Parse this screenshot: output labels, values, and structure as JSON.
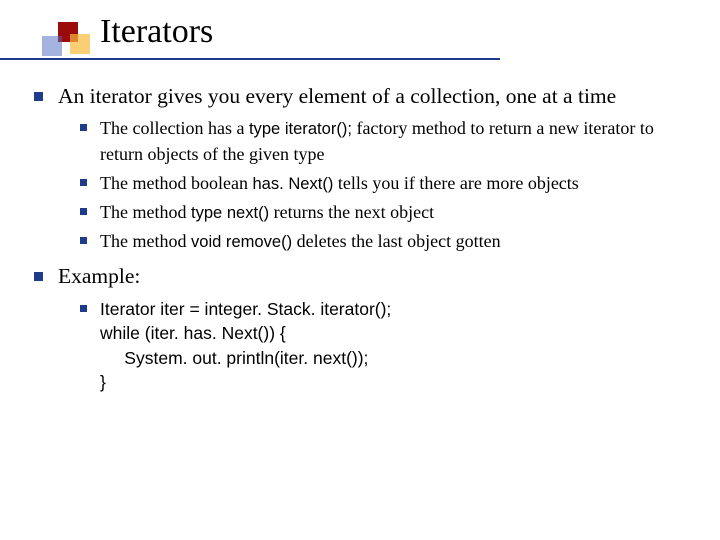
{
  "title": "Iterators",
  "bullets": [
    {
      "text": "An iterator gives you every element of a collection, one at a time",
      "sub": [
        {
          "segments": [
            {
              "t": "The collection has a "
            },
            {
              "t": "type iterator();",
              "code": true
            },
            {
              "t": " factory method to return a new iterator to return objects of the given type"
            }
          ]
        },
        {
          "segments": [
            {
              "t": "The method boolean "
            },
            {
              "t": "has. Next()",
              "code": true
            },
            {
              "t": " tells you if there are more objects"
            }
          ]
        },
        {
          "segments": [
            {
              "t": "The method "
            },
            {
              "t": "type next()",
              "code": true
            },
            {
              "t": " returns the next object"
            }
          ]
        },
        {
          "segments": [
            {
              "t": "The method "
            },
            {
              "t": "void remove()",
              "code": true
            },
            {
              "t": " deletes the last object gotten"
            }
          ]
        }
      ]
    },
    {
      "text": "Example:",
      "sub": [
        {
          "code_block": "Iterator iter = integer. Stack. iterator();\nwhile (iter. has. Next()) {\n     System. out. println(iter. next());\n}"
        }
      ]
    }
  ]
}
